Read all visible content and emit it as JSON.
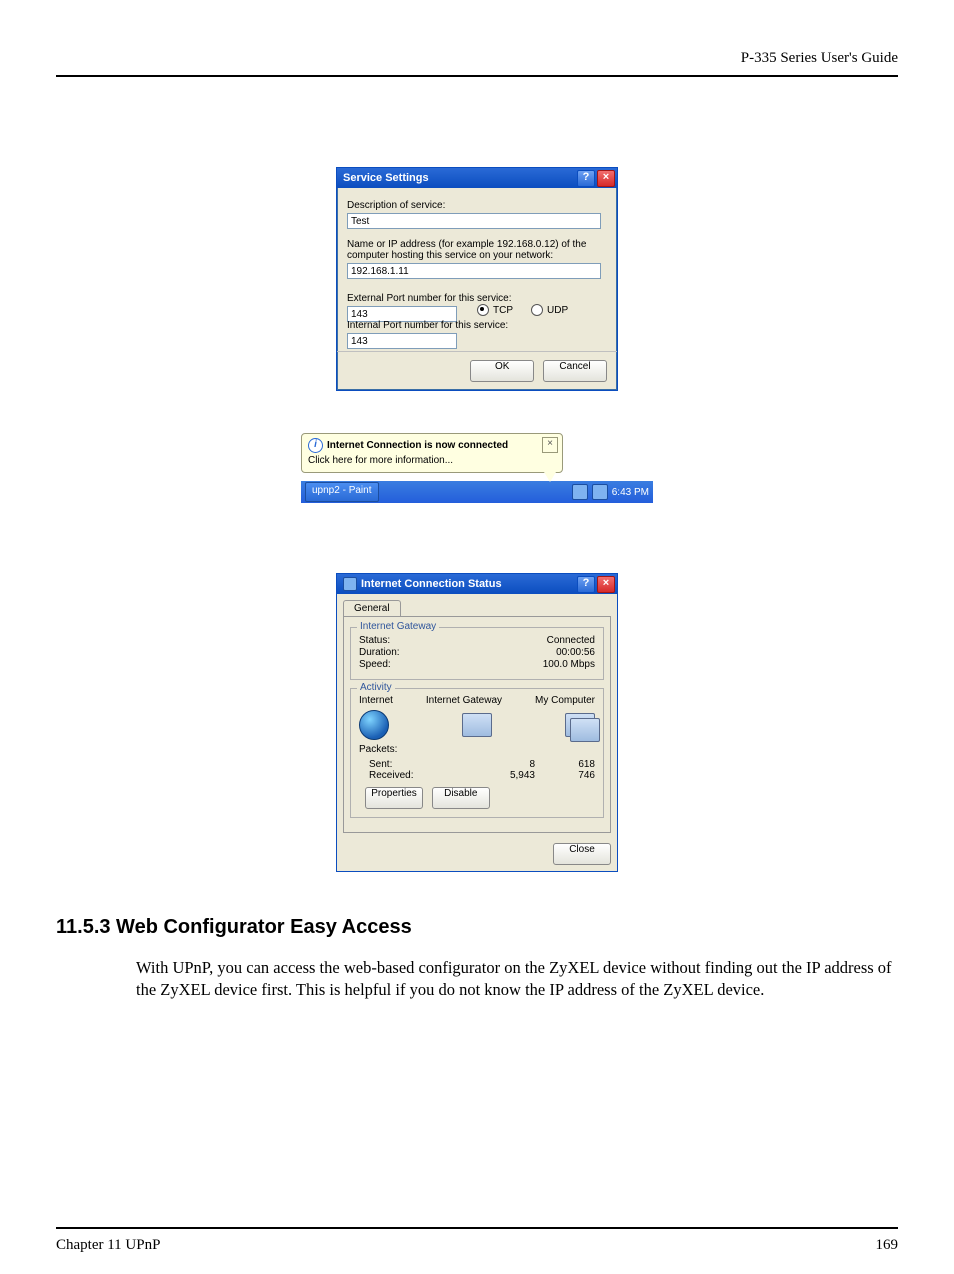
{
  "header": {
    "guide": "P-335 Series User's Guide"
  },
  "dlg1": {
    "title": "Service Settings",
    "desc_label": "Description of service:",
    "desc_value": "Test",
    "addr_label": "Name or IP address (for example 192.168.0.12) of the\ncomputer hosting this service on your network:",
    "addr_value": "192.168.1.11",
    "ext_label": "External Port number for this service:",
    "ext_value": "143",
    "tcp": "TCP",
    "udp": "UDP",
    "int_label": "Internal Port number for this service:",
    "int_value": "143",
    "ok": "OK",
    "cancel": "Cancel"
  },
  "balloon": {
    "title": "Internet Connection is now connected",
    "body": "Click here for more information...",
    "taskbtn": "upnp2 - Paint",
    "clock": "6:43 PM"
  },
  "dlg2": {
    "title": "Internet Connection Status",
    "tab": "General",
    "g1": "Internet Gateway",
    "status_k": "Status:",
    "status_v": "Connected",
    "dur_k": "Duration:",
    "dur_v": "00:00:56",
    "spd_k": "Speed:",
    "spd_v": "100.0 Mbps",
    "g2": "Activity",
    "col1": "Internet",
    "col2": "Internet Gateway",
    "col3": "My Computer",
    "pkts": "Packets:",
    "sent_k": "Sent:",
    "sent_a": "8",
    "sent_b": "618",
    "recv_k": "Received:",
    "recv_a": "5,943",
    "recv_b": "746",
    "props": "Properties",
    "disable": "Disable",
    "close": "Close"
  },
  "section": {
    "heading": "11.5.3  Web Configurator Easy Access",
    "para": "With UPnP, you can access the web-based configurator on the ZyXEL device without finding out the IP address of the ZyXEL device first. This is helpful if you do not know the IP address of the ZyXEL device."
  },
  "footer": {
    "left": "Chapter 11 UPnP",
    "right": "169"
  }
}
